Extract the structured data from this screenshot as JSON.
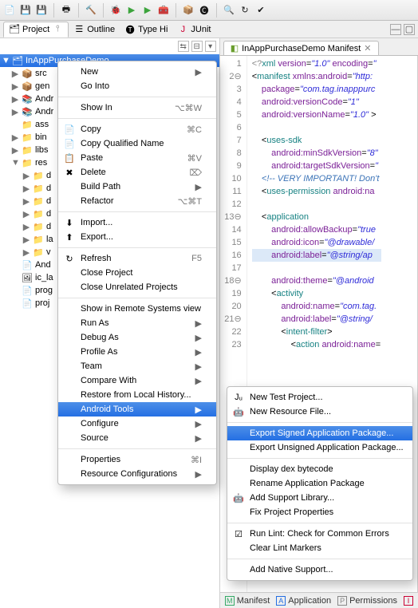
{
  "toolbar_icons": [
    "new",
    "save",
    "save-all",
    "print",
    "build",
    "debug-dropdown",
    "run-dropdown",
    "run-last",
    "ext-tools",
    "new-package",
    "new-class",
    "search",
    "task"
  ],
  "views": {
    "project": "Project",
    "outline": "Outline",
    "typehierarchy": "Type Hi",
    "junit": "JUnit"
  },
  "tree": {
    "root": "InAppPurchaseDemo",
    "children": [
      {
        "label": "src",
        "icon": "src-folder",
        "tw": "▶"
      },
      {
        "label": "gen",
        "icon": "src-folder",
        "tw": "▶"
      },
      {
        "label": "Andr",
        "icon": "jar",
        "tw": "▶"
      },
      {
        "label": "Andr",
        "icon": "jar",
        "tw": "▶"
      },
      {
        "label": "ass",
        "icon": "folder",
        "tw": ""
      },
      {
        "label": "bin",
        "icon": "folder",
        "tw": "▶"
      },
      {
        "label": "libs",
        "icon": "folder",
        "tw": "▶"
      },
      {
        "label": "res",
        "icon": "folder",
        "tw": "▼",
        "children": [
          {
            "label": "d",
            "icon": "folder",
            "tw": "▶"
          },
          {
            "label": "d",
            "icon": "folder",
            "tw": "▶"
          },
          {
            "label": "d",
            "icon": "folder",
            "tw": "▶"
          },
          {
            "label": "d",
            "icon": "folder",
            "tw": "▶"
          },
          {
            "label": "d",
            "icon": "folder",
            "tw": "▶"
          },
          {
            "label": "la",
            "icon": "folder",
            "tw": "▶"
          },
          {
            "label": "v",
            "icon": "folder",
            "tw": "▶"
          }
        ]
      },
      {
        "label": "And",
        "icon": "xml-file",
        "tw": ""
      },
      {
        "label": "ic_la",
        "icon": "image-file",
        "tw": ""
      },
      {
        "label": "prog",
        "icon": "text-file",
        "tw": ""
      },
      {
        "label": "proj",
        "icon": "text-file",
        "tw": ""
      }
    ]
  },
  "context_menu": [
    {
      "label": "New",
      "arrow": true
    },
    {
      "label": "Go Into"
    },
    {
      "sep": true
    },
    {
      "label": "Show In",
      "sc": "⌥⌘W",
      "arrow": true
    },
    {
      "sep": true
    },
    {
      "label": "Copy",
      "icon": "copy",
      "sc": "⌘C"
    },
    {
      "label": "Copy Qualified Name",
      "icon": "copy"
    },
    {
      "label": "Paste",
      "icon": "paste",
      "sc": "⌘V"
    },
    {
      "label": "Delete",
      "icon": "delete",
      "sc": "⌦"
    },
    {
      "label": "Build Path",
      "arrow": true
    },
    {
      "label": "Refactor",
      "sc": "⌥⌘T",
      "arrow": true
    },
    {
      "sep": true
    },
    {
      "label": "Import...",
      "icon": "import"
    },
    {
      "label": "Export...",
      "icon": "export"
    },
    {
      "sep": true
    },
    {
      "label": "Refresh",
      "icon": "refresh",
      "sc": "F5"
    },
    {
      "label": "Close Project"
    },
    {
      "label": "Close Unrelated Projects"
    },
    {
      "sep": true
    },
    {
      "label": "Show in Remote Systems view"
    },
    {
      "label": "Run As",
      "arrow": true
    },
    {
      "label": "Debug As",
      "arrow": true
    },
    {
      "label": "Profile As",
      "arrow": true
    },
    {
      "label": "Team",
      "arrow": true
    },
    {
      "label": "Compare With",
      "arrow": true
    },
    {
      "label": "Restore from Local History..."
    },
    {
      "label": "Android Tools",
      "arrow": true,
      "hl": true
    },
    {
      "label": "Configure",
      "arrow": true
    },
    {
      "label": "Source",
      "arrow": true
    },
    {
      "sep": true
    },
    {
      "label": "Properties",
      "sc": "⌘I"
    },
    {
      "label": "Resource Configurations",
      "arrow": true
    }
  ],
  "submenu": [
    {
      "label": "New Test Project...",
      "icon": "junit"
    },
    {
      "label": "New Resource File...",
      "icon": "android"
    },
    {
      "sep": true
    },
    {
      "label": "Export Signed Application Package...",
      "hl": true
    },
    {
      "label": "Export Unsigned Application Package..."
    },
    {
      "sep": true
    },
    {
      "label": "Display dex bytecode"
    },
    {
      "label": "Rename Application Package"
    },
    {
      "label": "Add Support Library...",
      "icon": "android"
    },
    {
      "label": "Fix Project Properties"
    },
    {
      "sep": true
    },
    {
      "label": "Run Lint: Check for Common Errors",
      "icon": "check"
    },
    {
      "label": "Clear Lint Markers"
    },
    {
      "sep": true
    },
    {
      "label": "Add Native Support..."
    }
  ],
  "editor": {
    "tab": "InAppPurchaseDemo Manifest",
    "subtabs": [
      "Manifest",
      "Application",
      "Permissions",
      "I"
    ],
    "lines": [
      {
        "n": 1,
        "html": "<span class='pi'>&lt;?</span><span class='kw'>xml</span> <span class='attr'>version</span>=<span class='str'>\"1.0\"</span> <span class='attr'>encoding</span>=<span class='str'>\"</span>"
      },
      {
        "n": 2,
        "fold": "⊖",
        "html": "&lt;<span class='kw'>manifest</span> <span class='attr'>xmlns:android</span>=<span class='str'>\"http:</span>"
      },
      {
        "n": 3,
        "html": "    <span class='attr'>package</span>=<span class='str'>\"com.tag.inapppurc</span>"
      },
      {
        "n": 4,
        "html": "    <span class='attr'>android:versionCode</span>=<span class='str'>\"1\"</span>"
      },
      {
        "n": 5,
        "html": "    <span class='attr'>android:versionName</span>=<span class='str'>\"1.0\"</span> &gt;"
      },
      {
        "n": 6,
        "html": ""
      },
      {
        "n": 7,
        "html": "    &lt;<span class='kw'>uses-sdk</span>"
      },
      {
        "n": 8,
        "html": "        <span class='attr'>android:minSdkVersion</span>=<span class='str'>\"8\"</span>"
      },
      {
        "n": 9,
        "html": "        <span class='attr'>android:targetSdkVersion</span>=<span class='str'>\"</span>"
      },
      {
        "n": 10,
        "html": "    <span class='cmt'>&lt;!-- VERY IMPORTANT! Don't </span>"
      },
      {
        "n": 11,
        "html": "    &lt;<span class='kw'>uses-permission</span> <span class='attr'>android:na</span>"
      },
      {
        "n": 12,
        "html": ""
      },
      {
        "n": 13,
        "fold": "⊖",
        "html": "    &lt;<span class='kw'>application</span>"
      },
      {
        "n": 14,
        "html": "        <span class='attr'>android:allowBackup</span>=<span class='str'>\"true</span>"
      },
      {
        "n": 15,
        "html": "        <span class='attr'>android:icon</span>=<span class='str'>\"@drawable/</span>"
      },
      {
        "n": 16,
        "hl": true,
        "html": "        <span class='attr'>android:label</span>=<span class='str'>\"@string/ap</span>"
      },
      {
        "n": 17,
        "html": "        <span class='attr'>android:theme</span>=<span class='str'>\"@android</span>"
      },
      {
        "n": 18,
        "fold": "⊖",
        "html": "        &lt;<span class='kw'>activity</span>"
      },
      {
        "n": 19,
        "html": "            <span class='attr'>android:name</span>=<span class='str'>\"com.tag.</span>"
      },
      {
        "n": 20,
        "html": "            <span class='attr'>android:label</span>=<span class='str'>\"@string/</span>"
      },
      {
        "n": 21,
        "fold": "⊖",
        "html": "            &lt;<span class='kw'>intent-filter</span>&gt;"
      },
      {
        "n": 22,
        "html": "                &lt;<span class='kw'>action</span> <span class='attr'>android:name</span>="
      },
      {
        "n": 23,
        "html": ""
      }
    ]
  }
}
